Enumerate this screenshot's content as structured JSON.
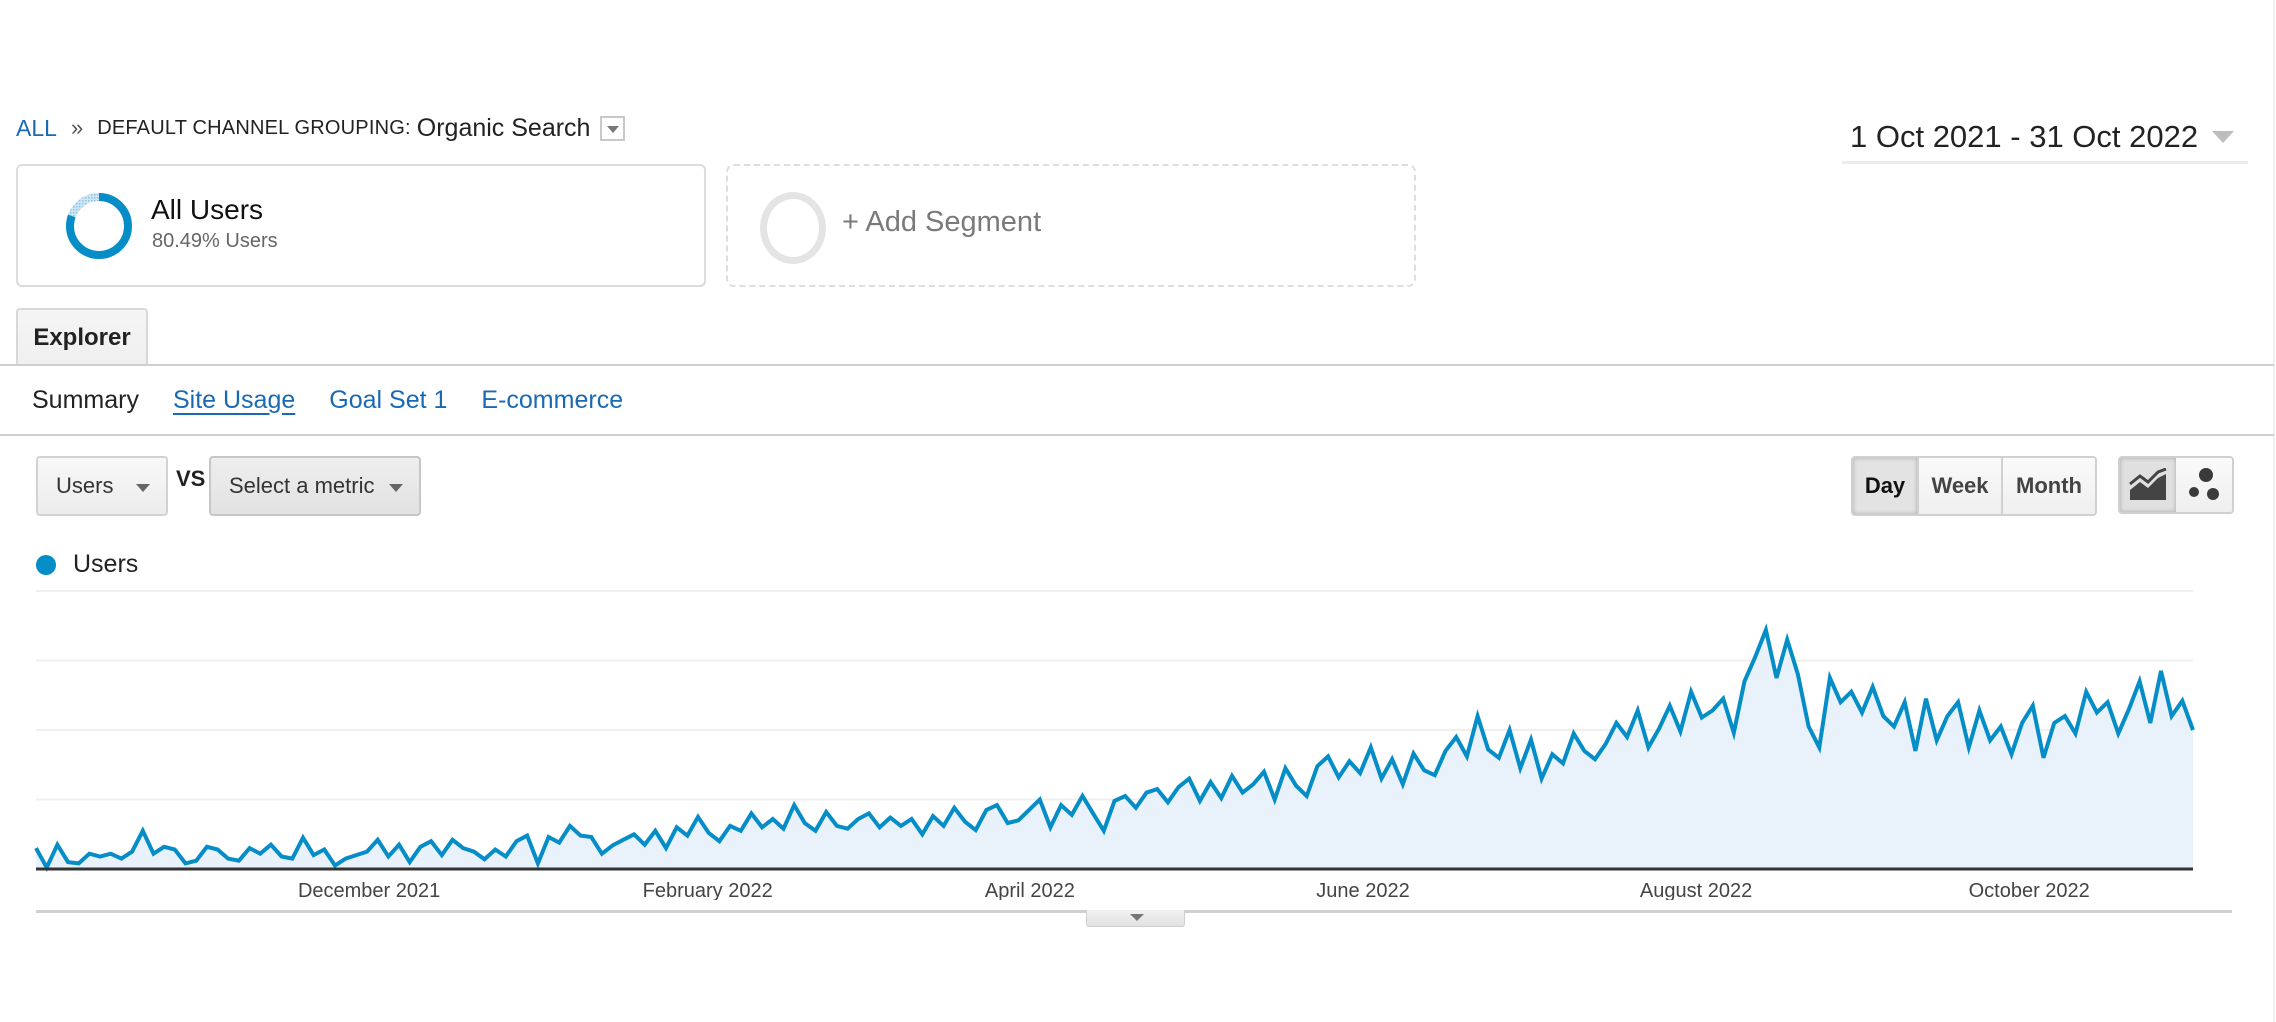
{
  "breadcrumb": {
    "root": "ALL",
    "separator": "»",
    "dimension": "DEFAULT CHANNEL GROUPING:",
    "value": "Organic Search"
  },
  "date_range": {
    "label": "1 Oct 2021 - 31 Oct 2022"
  },
  "segments": {
    "active": {
      "name": "All Users",
      "subtitle": "80.49% Users",
      "share": 0.8049,
      "color": "#058dc7"
    },
    "add_label": "+ Add Segment"
  },
  "tabs": [
    {
      "label": "Explorer",
      "active": true
    }
  ],
  "subnav": [
    {
      "label": "Summary",
      "active": true
    },
    {
      "label": "Site Usage",
      "active": false
    },
    {
      "label": "Goal Set 1",
      "active": false
    },
    {
      "label": "E-commerce",
      "active": false
    }
  ],
  "metric_selector": {
    "primary": "Users",
    "vs_label": "VS",
    "secondary": "Select a metric"
  },
  "granularity": {
    "options": [
      "Day",
      "Week",
      "Month"
    ],
    "selected": "Day"
  },
  "chart_types": [
    {
      "icon": "line-chart-icon",
      "active": true
    },
    {
      "icon": "motion-chart-icon",
      "active": false
    }
  ],
  "chart_data": {
    "type": "area",
    "title": "",
    "legend": [
      {
        "name": "Users",
        "color": "#058dc7"
      }
    ],
    "legend_position": "top-left",
    "xlabel": "",
    "ylabel": "",
    "y_unit_note": "y-axis unlabeled; values in gridline units (0 = baseline, 4 = top gridline)",
    "ylim": [
      0,
      4
    ],
    "grid": true,
    "gridlines": 4,
    "x_start": "2021-10-01",
    "x_end": "2022-10-31",
    "x_step_days": 3,
    "x_tick_labels": [
      {
        "label": "December 2021",
        "date": "2021-12-01"
      },
      {
        "label": "February 2022",
        "date": "2022-02-01"
      },
      {
        "label": "April 2022",
        "date": "2022-04-01"
      },
      {
        "label": "June 2022",
        "date": "2022-06-01"
      },
      {
        "label": "August 2022",
        "date": "2022-08-01"
      },
      {
        "label": "October 2022",
        "date": "2022-10-01"
      }
    ],
    "series": [
      {
        "name": "Users",
        "color": "#058dc7",
        "fill": "#e9f1fa",
        "values": [
          0.3,
          0.02,
          0.35,
          0.1,
          0.08,
          0.22,
          0.18,
          0.22,
          0.15,
          0.25,
          0.55,
          0.22,
          0.32,
          0.28,
          0.08,
          0.12,
          0.32,
          0.28,
          0.15,
          0.12,
          0.3,
          0.22,
          0.35,
          0.18,
          0.15,
          0.45,
          0.2,
          0.28,
          0.05,
          0.15,
          0.2,
          0.25,
          0.42,
          0.18,
          0.35,
          0.1,
          0.32,
          0.4,
          0.2,
          0.42,
          0.3,
          0.25,
          0.14,
          0.28,
          0.18,
          0.4,
          0.48,
          0.08,
          0.46,
          0.38,
          0.62,
          0.48,
          0.46,
          0.22,
          0.34,
          0.42,
          0.5,
          0.35,
          0.55,
          0.3,
          0.6,
          0.48,
          0.75,
          0.52,
          0.4,
          0.62,
          0.55,
          0.8,
          0.6,
          0.72,
          0.58,
          0.92,
          0.66,
          0.55,
          0.82,
          0.62,
          0.58,
          0.72,
          0.8,
          0.6,
          0.74,
          0.62,
          0.72,
          0.5,
          0.76,
          0.62,
          0.88,
          0.68,
          0.56,
          0.85,
          0.92,
          0.66,
          0.7,
          0.85,
          1.0,
          0.6,
          0.92,
          0.78,
          1.05,
          0.8,
          0.55,
          0.98,
          1.05,
          0.88,
          1.1,
          1.15,
          0.96,
          1.18,
          1.3,
          0.98,
          1.25,
          1.02,
          1.34,
          1.1,
          1.22,
          1.4,
          1.0,
          1.45,
          1.2,
          1.05,
          1.48,
          1.62,
          1.32,
          1.55,
          1.38,
          1.75,
          1.3,
          1.58,
          1.22,
          1.66,
          1.42,
          1.35,
          1.7,
          1.9,
          1.62,
          2.2,
          1.72,
          1.6,
          2.0,
          1.45,
          1.86,
          1.3,
          1.65,
          1.52,
          1.95,
          1.7,
          1.58,
          1.8,
          2.1,
          1.9,
          2.28,
          1.75,
          2.02,
          2.35,
          1.98,
          2.55,
          2.18,
          2.28,
          2.45,
          1.96,
          2.7,
          3.05,
          3.44,
          2.75,
          3.3,
          2.8,
          2.05,
          1.75,
          2.75,
          2.4,
          2.55,
          2.25,
          2.62,
          2.2,
          2.05,
          2.4,
          1.7,
          2.45,
          1.85,
          2.2,
          2.4,
          1.75,
          2.28,
          1.85,
          2.05,
          1.65,
          2.1,
          2.35,
          1.6,
          2.1,
          2.2,
          1.95,
          2.55,
          2.25,
          2.4,
          1.95,
          2.3,
          2.7,
          2.1,
          2.85,
          2.2,
          2.42,
          2.0
        ]
      }
    ]
  }
}
